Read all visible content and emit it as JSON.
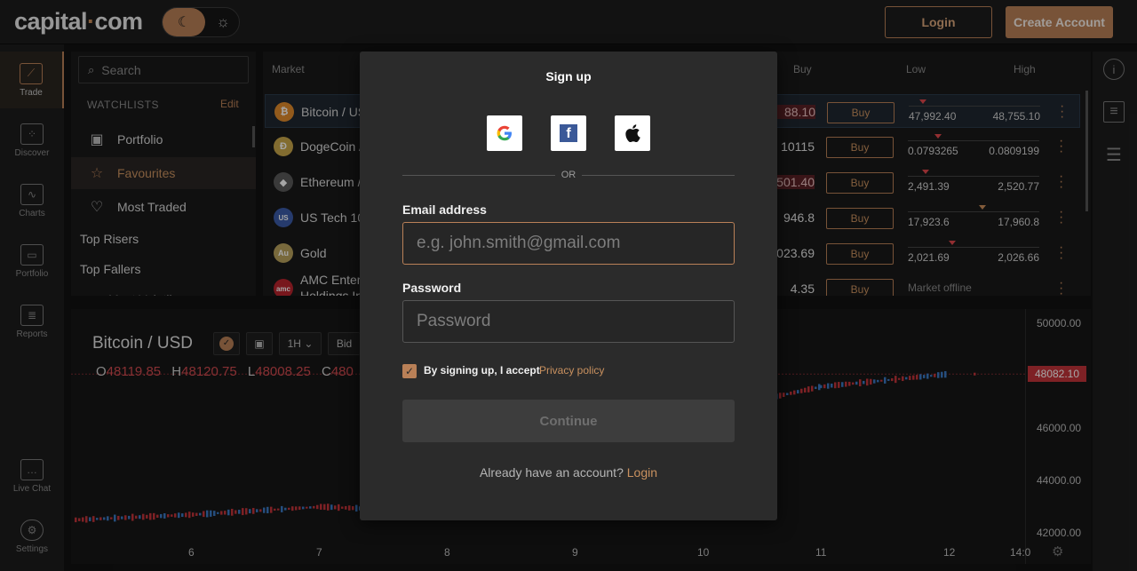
{
  "header": {
    "logo_main": "capital",
    "logo_dot": "·",
    "logo_suffix": "com",
    "login_label": "Login",
    "create_label": "Create Account"
  },
  "nav": [
    {
      "label": "Trade",
      "icon": "trend-icon"
    },
    {
      "label": "Discover",
      "icon": "nodes-icon"
    },
    {
      "label": "Charts",
      "icon": "chart-icon"
    },
    {
      "label": "Portfolio",
      "icon": "briefcase-icon"
    },
    {
      "label": "Reports",
      "icon": "report-icon"
    },
    {
      "label": "Live Chat",
      "icon": "chat-icon"
    },
    {
      "label": "Settings",
      "icon": "gear-icon"
    }
  ],
  "sidepanel": {
    "search_placeholder": "Search",
    "watchlists_title": "WATCHLISTS",
    "edit_label": "Edit",
    "items": [
      "Portfolio",
      "Favourites",
      "Most Traded"
    ],
    "plain_items": [
      "Top Risers",
      "Top Fallers",
      "Most Volatile"
    ]
  },
  "market": {
    "headers": {
      "market": "Market",
      "buy": "Buy",
      "low": "Low",
      "high": "High"
    },
    "buy_label": "Buy",
    "rows": [
      {
        "name": "Bitcoin / US",
        "name2": "",
        "sell": "88.10",
        "low": "47,992.40",
        "high": "48,755.10",
        "coin": "₿",
        "color": "#e08a2b"
      },
      {
        "name": "DogeCoin /",
        "name2": "",
        "sell": "10115",
        "low": "0.0793265",
        "high": "0.0809199",
        "coin": "Ð",
        "color": "#c8a64b"
      },
      {
        "name": "Ethereum /",
        "name2": "",
        "sell": "501.40",
        "low": "2,491.39",
        "high": "2,520.77",
        "coin": "◆",
        "color": "#5a5a5a"
      },
      {
        "name": "US Tech 10",
        "name2": "",
        "sell": "946.8",
        "low": "17,923.6",
        "high": "17,960.8",
        "coin": "US",
        "color": "#3b5ba8"
      },
      {
        "name": "Gold",
        "name2": "",
        "sell": "023.69",
        "low": "2,021.69",
        "high": "2,026.66",
        "coin": "Au",
        "color": "#b8a15c"
      },
      {
        "name": "AMC Enter",
        "name2": "Holdings In",
        "sell": "4.35",
        "low": "",
        "high": "",
        "coin": "amc",
        "color": "#b8242d",
        "offline": "Market offline"
      }
    ]
  },
  "chart": {
    "title": "Bitcoin / USD",
    "timeframe": "1H",
    "price_mode": "Bid",
    "ohlc": {
      "o": "48119.85",
      "h": "48120.75",
      "l": "48008.25",
      "c": "480"
    },
    "y_labels": [
      "50000.00",
      "46000.00",
      "44000.00",
      "42000.00"
    ],
    "x_labels": [
      "6",
      "7",
      "8",
      "9",
      "10",
      "11",
      "12",
      "14:0"
    ],
    "current_price": "48082.10"
  },
  "modal": {
    "title": "Sign up",
    "or_text": "OR",
    "email_label": "Email address",
    "email_placeholder": "e.g. john.smith@gmail.com",
    "password_label": "Password",
    "password_placeholder": "Password",
    "agree_text": "By signing up, I accept",
    "privacy_label": "Privacy policy",
    "continue_label": "Continue",
    "have_account_text": "Already have an account?",
    "login_link": "Login"
  },
  "chart_data": {
    "type": "line",
    "x": [
      "6",
      "7",
      "8",
      "9",
      "10",
      "11",
      "12"
    ],
    "values": [
      42700,
      43000,
      42800,
      42800,
      46600,
      47600,
      48082
    ],
    "ylim": [
      41800,
      50300
    ]
  }
}
